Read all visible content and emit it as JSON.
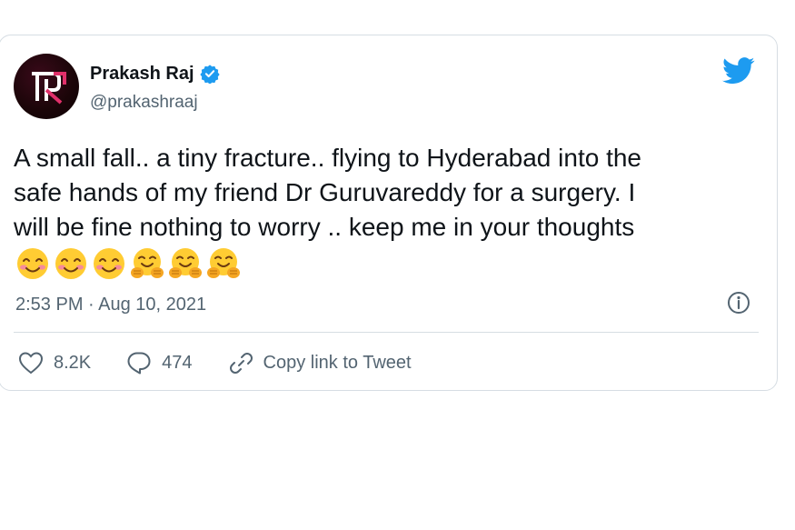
{
  "tweet": {
    "author_name": "Prakash Raj",
    "author_handle": "@prakashraaj",
    "text": "A small fall.. a tiny fracture.. flying to  Hyderabad into the\nsafe hands of my friend Dr Guruvareddy for a surgery. I\nwill be fine nothing to worry .. keep me in your thoughts",
    "emojis": [
      "😊",
      "😊",
      "😊",
      "🤗",
      "🤗",
      "🤗"
    ],
    "timestamp": "2:53 PM · Aug 10, 2021"
  },
  "actions": {
    "likes": "8.2K",
    "replies": "474",
    "copy_link_label": "Copy link to Tweet"
  },
  "colors": {
    "twitter_blue": "#1d9bf0",
    "text": "#0f1419",
    "muted": "#536471",
    "border": "#d6dde3",
    "avatar_accent": "#e0306a"
  },
  "icons": {
    "verified": "verified-badge-icon",
    "bird": "twitter-bird-icon",
    "info": "info-icon",
    "like": "heart-icon",
    "reply": "reply-bubble-icon",
    "link": "link-icon"
  }
}
